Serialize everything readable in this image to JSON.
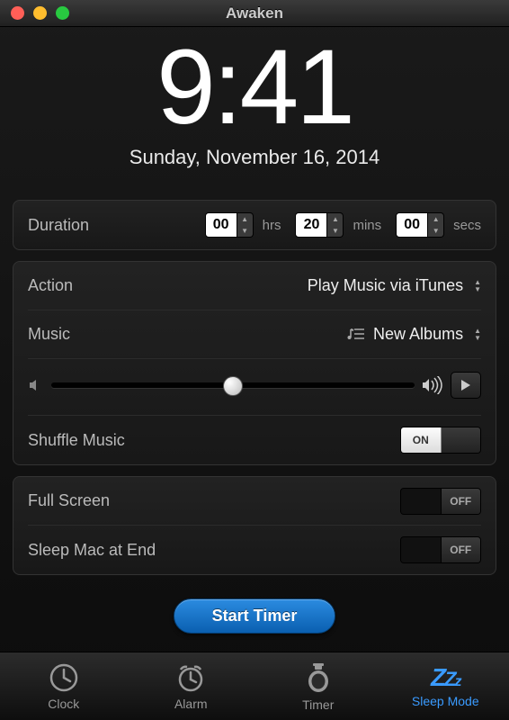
{
  "window": {
    "title": "Awaken"
  },
  "clock": {
    "time": "9:41",
    "date": "Sunday, November 16, 2014"
  },
  "duration": {
    "label": "Duration",
    "hrs": "00",
    "hrs_unit": "hrs",
    "mins": "20",
    "mins_unit": "mins",
    "secs": "00",
    "secs_unit": "secs"
  },
  "action": {
    "label": "Action",
    "value": "Play Music via iTunes"
  },
  "music": {
    "label": "Music",
    "value": "New Albums"
  },
  "shuffle": {
    "label": "Shuffle Music",
    "state": "ON"
  },
  "fullscreen": {
    "label": "Full Screen",
    "state": "OFF"
  },
  "sleep_mac": {
    "label": "Sleep Mac at End",
    "state": "OFF"
  },
  "start": {
    "label": "Start Timer"
  },
  "tabs": {
    "clock": "Clock",
    "alarm": "Alarm",
    "timer": "Timer",
    "sleep": "Sleep Mode"
  },
  "toggle_labels": {
    "on": "ON",
    "off": "OFF"
  }
}
